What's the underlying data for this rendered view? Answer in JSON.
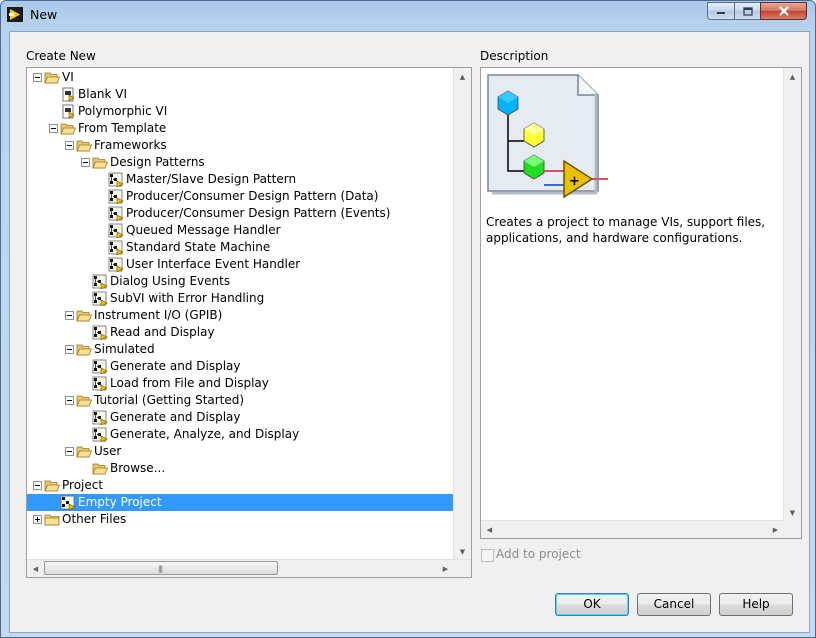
{
  "window": {
    "title": "New"
  },
  "create_new_label": "Create New",
  "description_label": "Description",
  "tree": [
    {
      "label": "VI",
      "level": 0,
      "icon": "folder-open-icon",
      "expander": "minus"
    },
    {
      "label": "Blank VI",
      "level": 1,
      "icon": "vi-file-icon"
    },
    {
      "label": "Polymorphic VI",
      "level": 1,
      "icon": "vi-file-icon"
    },
    {
      "label": "From Template",
      "level": 1,
      "icon": "folder-open-icon",
      "expander": "minus"
    },
    {
      "label": "Frameworks",
      "level": 2,
      "icon": "folder-open-icon",
      "expander": "minus"
    },
    {
      "label": "Design Patterns",
      "level": 3,
      "icon": "folder-open-icon",
      "expander": "minus"
    },
    {
      "label": "Master/Slave Design Pattern",
      "level": 4,
      "icon": "template-icon"
    },
    {
      "label": "Producer/Consumer Design Pattern (Data)",
      "level": 4,
      "icon": "template-icon"
    },
    {
      "label": "Producer/Consumer Design Pattern (Events)",
      "level": 4,
      "icon": "template-icon"
    },
    {
      "label": "Queued Message Handler",
      "level": 4,
      "icon": "template-icon"
    },
    {
      "label": "Standard State Machine",
      "level": 4,
      "icon": "template-icon"
    },
    {
      "label": "User Interface Event Handler",
      "level": 4,
      "icon": "template-icon"
    },
    {
      "label": "Dialog Using Events",
      "level": 3,
      "icon": "template-icon"
    },
    {
      "label": "SubVI with Error Handling",
      "level": 3,
      "icon": "template-icon"
    },
    {
      "label": "Instrument I/O (GPIB)",
      "level": 2,
      "icon": "folder-open-icon",
      "expander": "minus"
    },
    {
      "label": "Read and Display",
      "level": 3,
      "icon": "template-icon"
    },
    {
      "label": "Simulated",
      "level": 2,
      "icon": "folder-open-icon",
      "expander": "minus"
    },
    {
      "label": "Generate and Display",
      "level": 3,
      "icon": "template-icon"
    },
    {
      "label": "Load from File and Display",
      "level": 3,
      "icon": "template-icon"
    },
    {
      "label": "Tutorial (Getting Started)",
      "level": 2,
      "icon": "folder-open-icon",
      "expander": "minus"
    },
    {
      "label": "Generate and Display",
      "level": 3,
      "icon": "template-icon"
    },
    {
      "label": "Generate, Analyze, and Display",
      "level": 3,
      "icon": "template-icon"
    },
    {
      "label": "User",
      "level": 2,
      "icon": "folder-open-icon",
      "expander": "minus"
    },
    {
      "label": "Browse...",
      "level": 3,
      "icon": "folder-open-icon"
    },
    {
      "label": "Project",
      "level": 0,
      "icon": "folder-open-icon",
      "expander": "minus"
    },
    {
      "label": "Empty Project",
      "level": 1,
      "icon": "project-icon",
      "selected": true
    },
    {
      "label": "Other Files",
      "level": 0,
      "icon": "folder-icon",
      "expander": "plus"
    }
  ],
  "description": {
    "text": "Creates a project to manage VIs, support files, applications, and hardware configurations."
  },
  "add_to_project": {
    "label": "Add to project",
    "checked": false,
    "enabled": false
  },
  "buttons": {
    "ok": "OK",
    "cancel": "Cancel",
    "help": "Help"
  },
  "colors": {
    "selection": "#3399ff",
    "title_bar": "#b9d3ee"
  }
}
